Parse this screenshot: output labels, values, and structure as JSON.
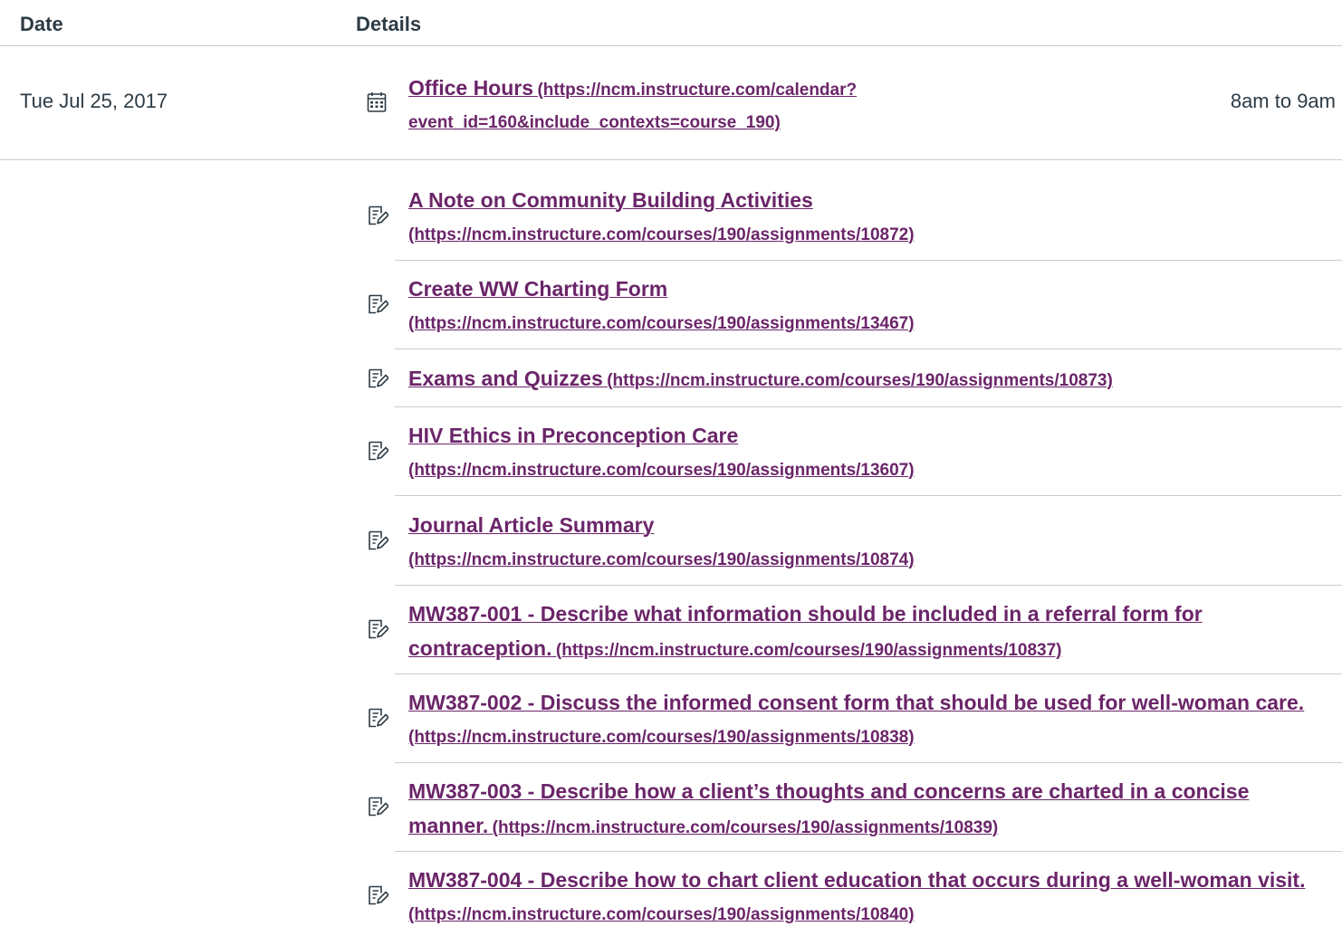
{
  "table": {
    "headers": {
      "date": "Date",
      "details": "Details"
    },
    "rows": [
      {
        "date": "Tue Jul 25, 2017",
        "items": [
          {
            "icon": "calendar-icon",
            "title": "Office Hours",
            "url": "(https://ncm.instructure.com/calendar?event_id=160&include_contexts=course_190)",
            "time": "8am to 9am"
          }
        ]
      },
      {
        "date": "",
        "items": [
          {
            "icon": "assignment-icon",
            "title": "A Note on Community Building Activities",
            "url": "(https://ncm.instructure.com/courses/190/assignments/10872)"
          },
          {
            "icon": "assignment-icon",
            "title": "Create WW Charting Form",
            "url": "(https://ncm.instructure.com/courses/190/assignments/13467)"
          },
          {
            "icon": "assignment-icon",
            "title": "Exams and Quizzes",
            "url": "(https://ncm.instructure.com/courses/190/assignments/10873)"
          },
          {
            "icon": "assignment-icon",
            "title": "HIV Ethics in Preconception Care",
            "url": "(https://ncm.instructure.com/courses/190/assignments/13607)"
          },
          {
            "icon": "assignment-icon",
            "title": "Journal Article Summary",
            "url": "(https://ncm.instructure.com/courses/190/assignments/10874)"
          },
          {
            "icon": "assignment-icon",
            "title": "MW387-001 - Describe what information should be included in a referral form for contraception.",
            "url": "(https://ncm.instructure.com/courses/190/assignments/10837)"
          },
          {
            "icon": "assignment-icon",
            "title": "MW387-002 - Discuss the informed consent form that should be used for well-woman care.",
            "url": "(https://ncm.instructure.com/courses/190/assignments/10838)"
          },
          {
            "icon": "assignment-icon",
            "title": "MW387-003 - Describe how a client’s thoughts and concerns are charted in a concise manner.",
            "url": "(https://ncm.instructure.com/courses/190/assignments/10839)"
          },
          {
            "icon": "assignment-icon",
            "title": "MW387-004 - Describe how to chart client education that occurs during a well-woman visit.",
            "url": "(https://ncm.instructure.com/courses/190/assignments/10840)"
          }
        ]
      }
    ]
  },
  "colors": {
    "link": "#6b2569",
    "text": "#2d3b45",
    "divider": "#c7cdd1"
  }
}
